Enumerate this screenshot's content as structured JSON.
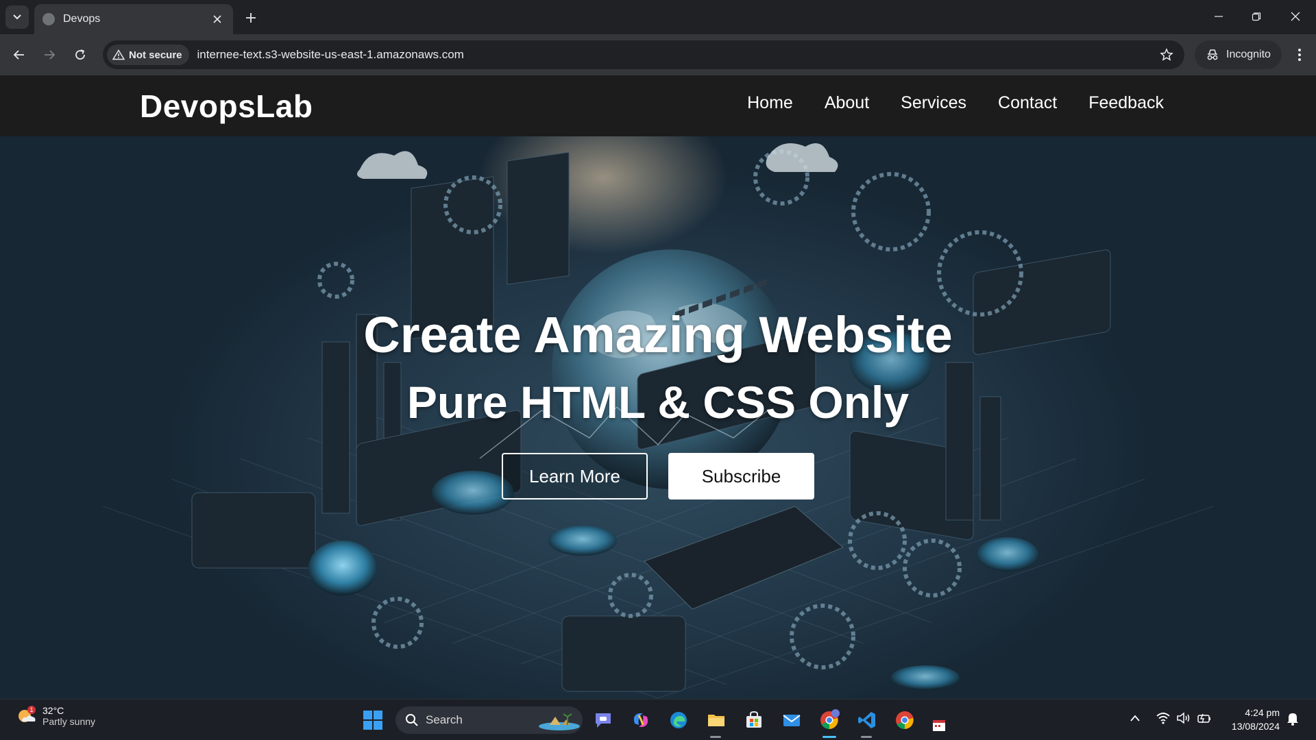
{
  "browser": {
    "tab_title": "Devops",
    "security_label": "Not secure",
    "url": "internee-text.s3-website-us-east-1.amazonaws.com",
    "profile_label": "Incognito"
  },
  "site": {
    "logo": "DevopsLab",
    "nav": [
      "Home",
      "About",
      "Services",
      "Contact",
      "Feedback"
    ],
    "hero_title": "Create Amazing Website",
    "hero_subtitle": "Pure HTML & CSS Only",
    "learn_more": "Learn More",
    "subscribe": "Subscribe"
  },
  "taskbar": {
    "weather_temp": "32°C",
    "weather_desc": "Partly sunny",
    "weather_badge": "1",
    "search_placeholder": "Search",
    "time": "4:24 pm",
    "date": "13/08/2024"
  },
  "colors": {
    "chrome_dark": "#202124",
    "chrome_toolbar": "#35363a",
    "site_header": "#1c1c1c",
    "hero_blue": "#2f4b5d",
    "accent_cyan": "#4fc3f7"
  }
}
